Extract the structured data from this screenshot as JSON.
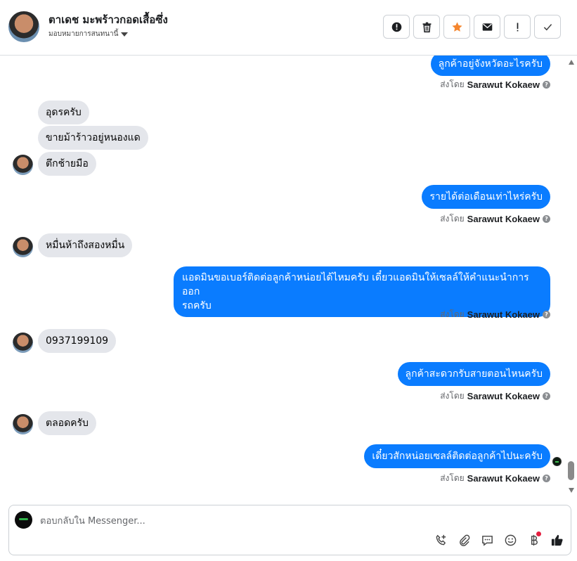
{
  "header": {
    "contact_name": "ตาเดช มะพร้าวกอดเสื้อซึ่ง",
    "assign_label": "มอบหมายการสนทนานี้",
    "actions": [
      {
        "icon": "alert-circle-icon",
        "name": "mark-spam-button"
      },
      {
        "icon": "trash-icon",
        "name": "delete-button"
      },
      {
        "icon": "star-icon",
        "name": "star-button"
      },
      {
        "icon": "envelope-icon",
        "name": "mark-unread-button"
      },
      {
        "icon": "exclamation-icon",
        "name": "follow-up-button"
      },
      {
        "icon": "check-icon",
        "name": "mark-done-button"
      }
    ],
    "star_color": "#f5862e"
  },
  "thread": {
    "sent_by_prefix": "ส่งโดย",
    "sender_name": "Sarawut Kokaew",
    "messages": [
      {
        "dir": "out",
        "text": "ลูกค้าอยู่จังหวัดอะไรครับ"
      },
      {
        "dir": "in",
        "text": "อุดรครับ"
      },
      {
        "dir": "in",
        "text": "ขายม้าร้าวอยู่หนองแด"
      },
      {
        "dir": "in",
        "text": "ตึกช้ายมือ"
      },
      {
        "dir": "out",
        "text": "รายได้ต่อเดือนเท่าไหร่ครับ"
      },
      {
        "dir": "in",
        "text": "หมื่นห้าถึงสองหมื่น"
      },
      {
        "dir": "out",
        "text": "แอดมินขอเบอร์ติดต่อลูกค้าหน่อยได้ไหมครับ เดี๋ยวแอดมินให้เซลล์ให้คำแนะนำการออก",
        "text2": "รถครับ"
      },
      {
        "dir": "in",
        "text": "0937199109"
      },
      {
        "dir": "out",
        "text": "ลูกค้าสะดวกรับสายตอนไหนครับ"
      },
      {
        "dir": "in",
        "text": "ตลอดครับ"
      },
      {
        "dir": "out",
        "text": "เดี๋ยวสักหน่อยเซลล์ติดต่อลูกค้าไปนะครับ"
      }
    ],
    "outgoing_color": "#0a7cff",
    "incoming_color": "#e4e6eb"
  },
  "composer": {
    "placeholder": "ตอบกลับใน Messenger...",
    "tools": [
      "phone-plus-icon",
      "paperclip-icon",
      "saved-reply-icon",
      "emoji-icon",
      "baht-icon",
      "thumbs-up-icon"
    ],
    "notification_color": "#e41e3f"
  }
}
